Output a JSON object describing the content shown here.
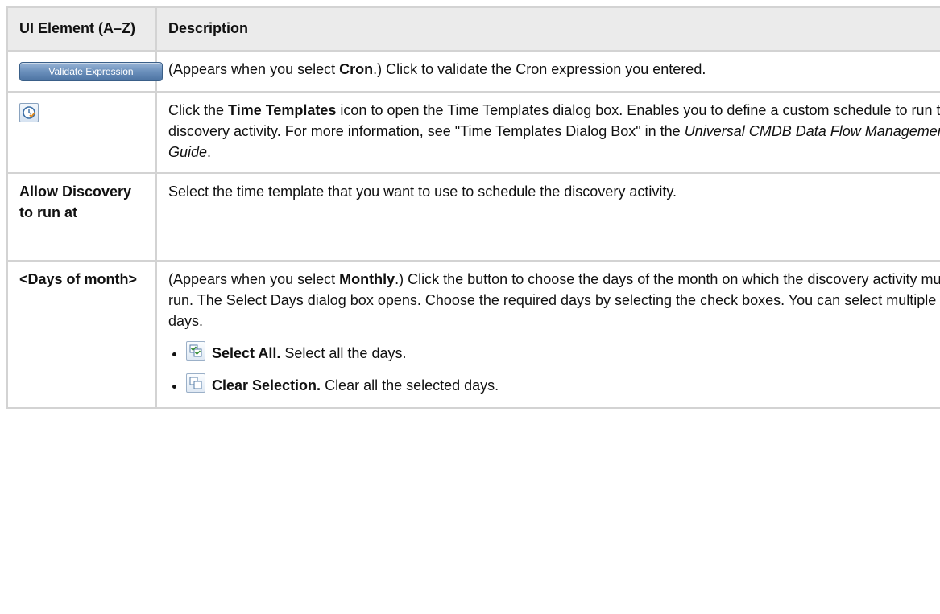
{
  "header": {
    "col1": "UI Element (A–Z)",
    "col2": "Description"
  },
  "rows": [
    {
      "button_label": "Validate Expression",
      "desc": {
        "p1": "(Appears when you select ",
        "b1": "Cron",
        "p2": ".) Click to validate the Cron expression you entered."
      }
    },
    {
      "icon": "time-templates-icon",
      "desc": {
        "p1": "Click the ",
        "b1": "Time Templates",
        "p2": " icon to open the Time Templates dialog box. Enables you to define a custom schedule to run the discovery activity. For more information, see \"Time Templates Dialog Box\" in the ",
        "i1": "Universal CMDB Data Flow Management Guide",
        "p3": "."
      }
    },
    {
      "name": "Allow Discovery to run at",
      "desc": {
        "p1": "Select the time template that you want to use to schedule the discovery activity."
      }
    },
    {
      "name": "<Days of month>",
      "desc": {
        "p1": "(Appears when you select ",
        "b1": "Monthly",
        "p2": ".) Click the button to choose the days of the month on which the discovery activity must run. The Select Days dialog box opens. Choose the required days by selecting the check boxes. You can select multiple days."
      },
      "bullets": [
        {
          "icon": "select-all-icon",
          "label": "Select All.",
          "text": " Select all the days."
        },
        {
          "icon": "clear-selection-icon",
          "label": "Clear Selection.",
          "text": " Clear all the selected days."
        }
      ]
    }
  ]
}
